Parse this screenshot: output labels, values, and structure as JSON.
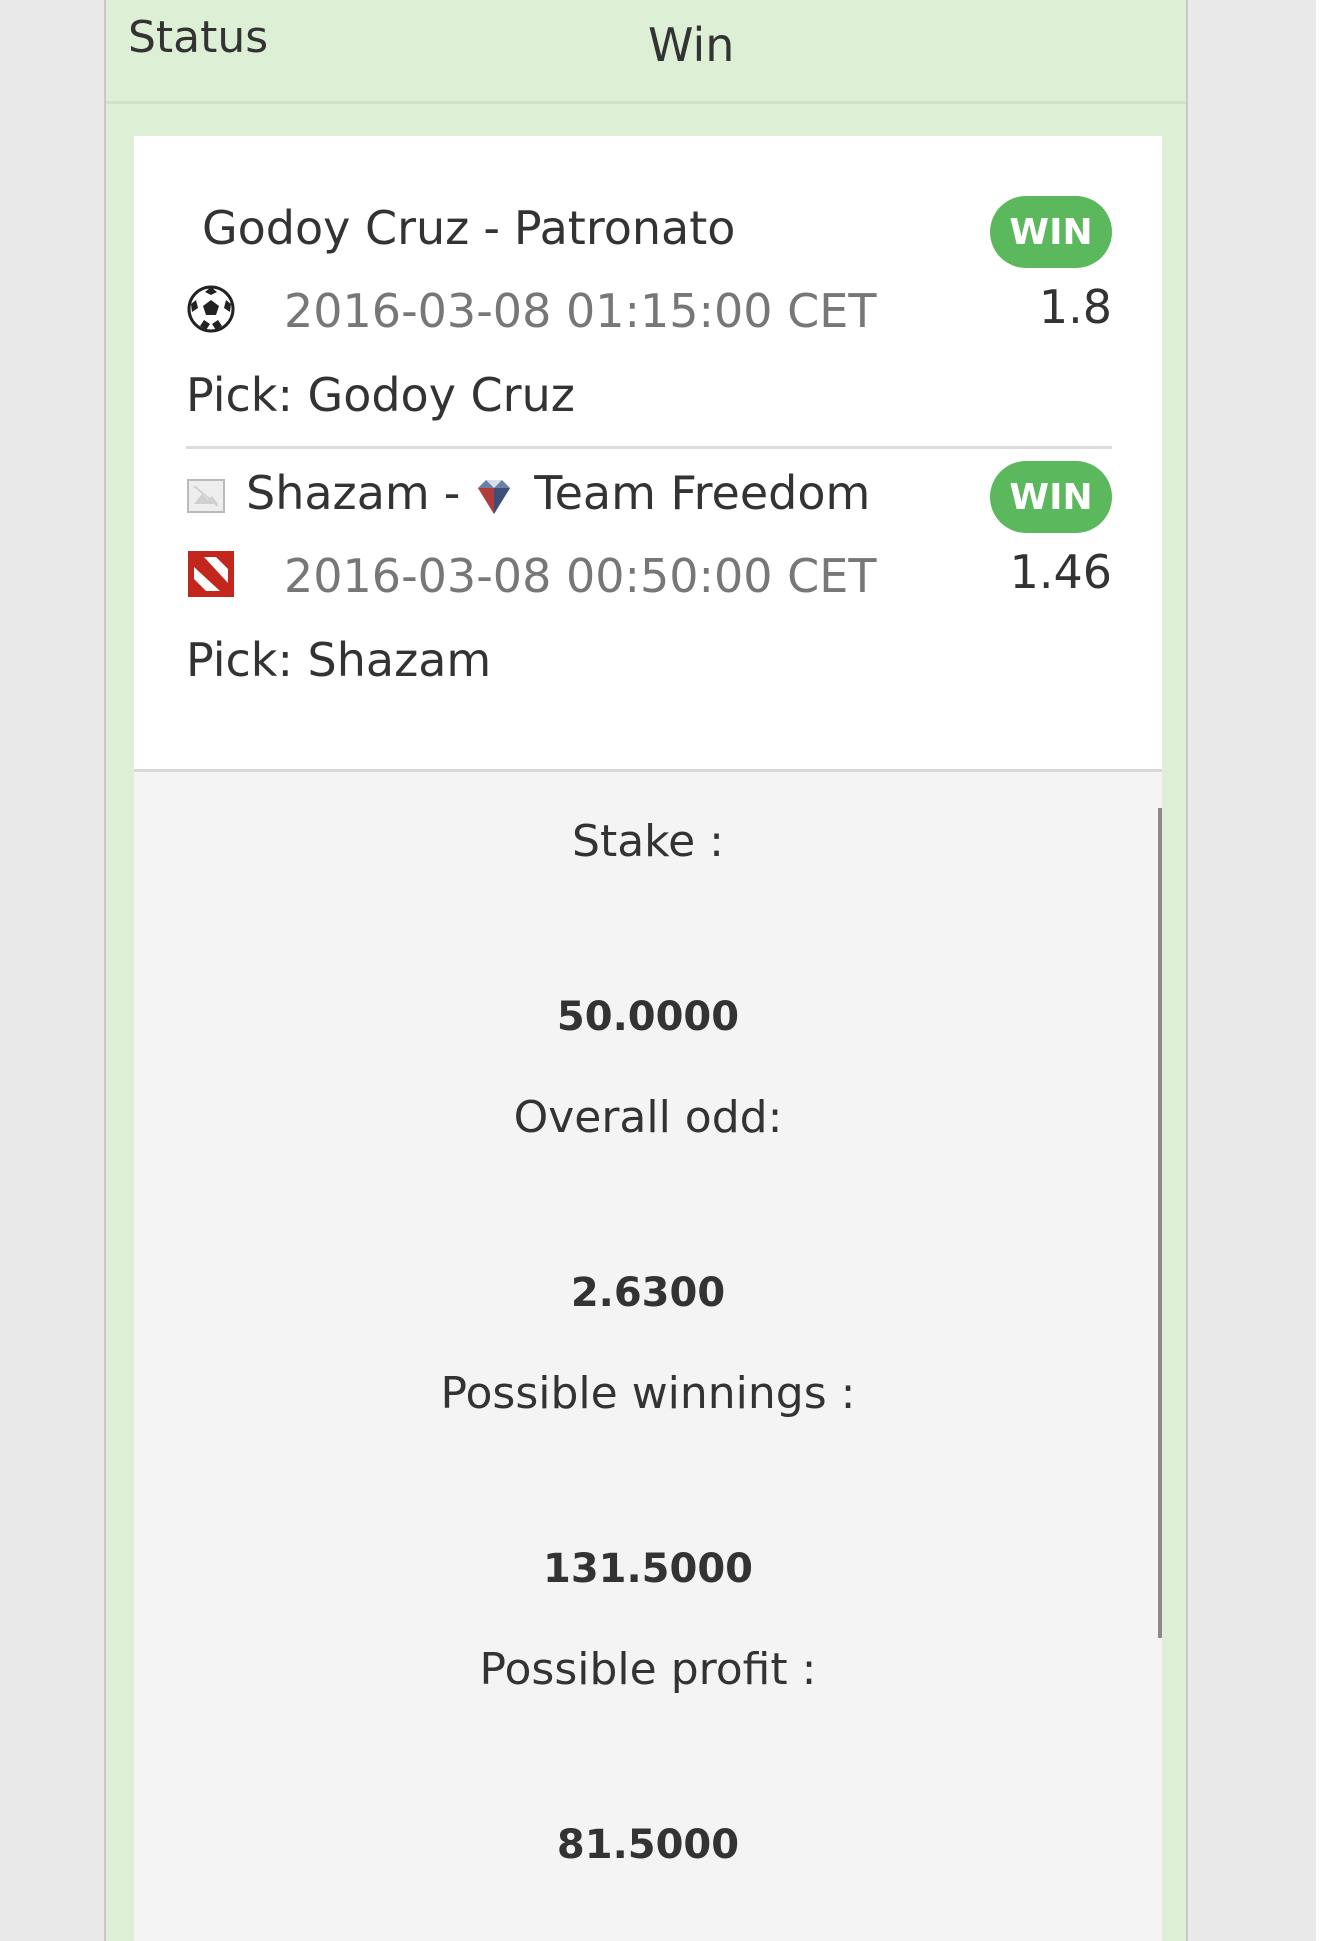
{
  "status": {
    "label": "Status",
    "value": "Win"
  },
  "events": [
    {
      "home": "Godoy Cruz",
      "separator": "-",
      "away": "Patronato",
      "sport_icon": "soccer-ball-icon",
      "datetime": "2016-03-08 01:15:00 CET",
      "pick": "Pick: Godoy Cruz",
      "result": "WIN",
      "odd": "1.8"
    },
    {
      "home": "Shazam",
      "separator": "-",
      "away": "Team Freedom",
      "home_icon": "broken-image-icon",
      "away_icon": "diamond-team-logo-icon",
      "sport_icon": "dota2-icon",
      "datetime": "2016-03-08 00:50:00 CET",
      "pick": "Pick: Shazam",
      "result": "WIN",
      "odd": "1.46"
    }
  ],
  "summary": {
    "stake_label": "Stake :",
    "stake_value": "50.0000",
    "overall_odd_label": "Overall odd:",
    "overall_odd_value": "2.6300",
    "possible_winnings_label": "Possible winnings :",
    "possible_winnings_value": "131.5000",
    "possible_profit_label": "Possible profit :",
    "possible_profit_value": "81.5000"
  },
  "colors": {
    "panel_bg": "#ddf0d6",
    "badge_bg": "#5cb85c",
    "muted_text": "#777777"
  }
}
